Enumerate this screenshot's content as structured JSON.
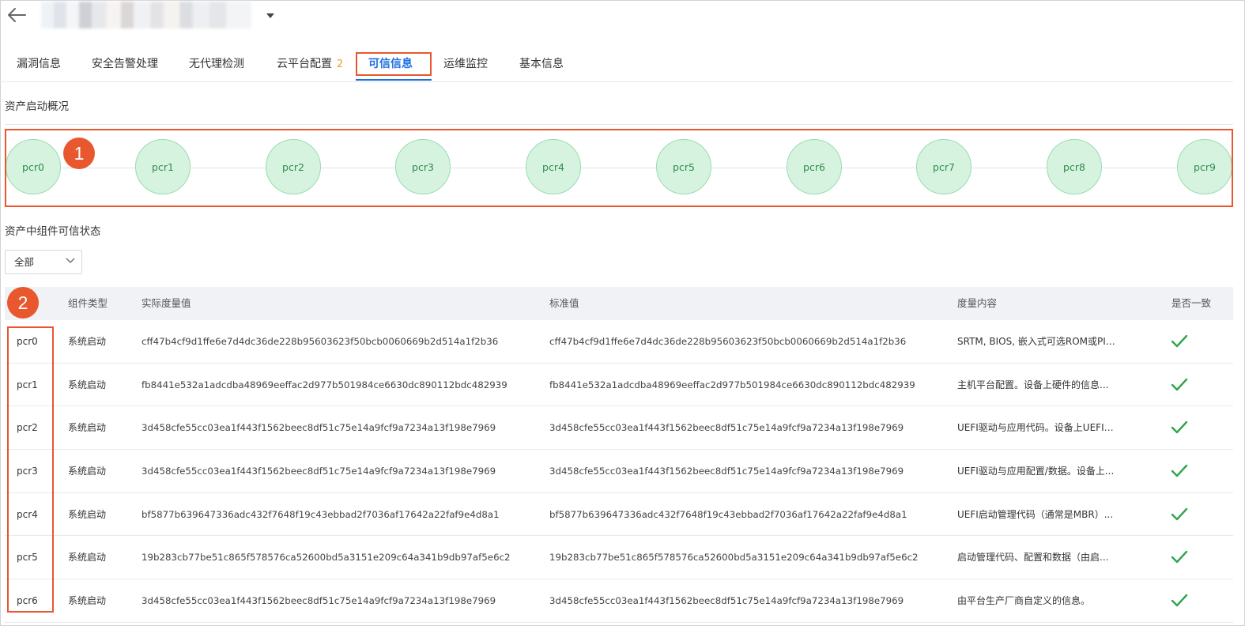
{
  "header": {
    "back_label": "back-arrow-icon",
    "asset_name": ""
  },
  "tabs": [
    {
      "label": "漏洞信息",
      "badge": ""
    },
    {
      "label": "安全告警处理",
      "badge": ""
    },
    {
      "label": "无代理检测",
      "badge": ""
    },
    {
      "label": "云平台配置",
      "badge": "2"
    },
    {
      "label": "可信信息",
      "badge": ""
    },
    {
      "label": "运维监控",
      "badge": ""
    },
    {
      "label": "基本信息",
      "badge": ""
    }
  ],
  "active_tab": "可信信息",
  "boot_overview": {
    "title": "资产启动概况",
    "nodes": [
      "pcr0",
      "pcr1",
      "pcr2",
      "pcr3",
      "pcr4",
      "pcr5",
      "pcr6",
      "pcr7",
      "pcr8",
      "pcr9"
    ]
  },
  "markers": {
    "one": "1",
    "two": "2"
  },
  "components": {
    "title": "资产中组件可信状态",
    "filter_value": "全部",
    "columns": [
      "",
      "组件类型",
      "实际度量值",
      "标准值",
      "度量内容",
      "是否一致"
    ],
    "rows": [
      {
        "pcr": "pcr0",
        "type": "系统启动",
        "actual": "cff47b4cf9d1ffe6e7d4dc36de228b95603623f50bcb0060669b2d514a1f2b36",
        "standard": "cff47b4cf9d1ffe6e7d4dc36de228b95603623f50bcb0060669b2d514a1f2b36",
        "content": "SRTM, BIOS, 嵌入式可选ROM或PI驱...",
        "consistent": true
      },
      {
        "pcr": "pcr1",
        "type": "系统启动",
        "actual": "fb8441e532a1adcdba48969eeffac2d977b501984ce6630dc890112bdc482939",
        "standard": "fb8441e532a1adcdba48969eeffac2d977b501984ce6630dc890112bdc482939",
        "content": "主机平台配置。设备上硬件的信息...",
        "consistent": true
      },
      {
        "pcr": "pcr2",
        "type": "系统启动",
        "actual": "3d458cfe55cc03ea1f443f1562beec8df51c75e14a9fcf9a7234a13f198e7969",
        "standard": "3d458cfe55cc03ea1f443f1562beec8df51c75e14a9fcf9a7234a13f198e7969",
        "content": "UEFI驱动与应用代码。设备上UEFI固...",
        "consistent": true
      },
      {
        "pcr": "pcr3",
        "type": "系统启动",
        "actual": "3d458cfe55cc03ea1f443f1562beec8df51c75e14a9fcf9a7234a13f198e7969",
        "standard": "3d458cfe55cc03ea1f443f1562beec8df51c75e14a9fcf9a7234a13f198e7969",
        "content": "UEFI驱动与应用配置/数据。设备上...",
        "consistent": true
      },
      {
        "pcr": "pcr4",
        "type": "系统启动",
        "actual": "bf5877b639647336adc432f7648f19c43ebbad2f7036af17642a22faf9e4d8a1",
        "standard": "bf5877b639647336adc432f7648f19c43ebbad2f7036af17642a22faf9e4d8a1",
        "content": "UEFI启动管理代码（通常是MBR）...",
        "consistent": true
      },
      {
        "pcr": "pcr5",
        "type": "系统启动",
        "actual": "19b283cb77be51c865f578576ca52600bd5a3151e209c64a341b9db97af5e6c2",
        "standard": "19b283cb77be51c865f578576ca52600bd5a3151e209c64a341b9db97af5e6c2",
        "content": "启动管理代码、配置和数据（由启...",
        "consistent": true
      },
      {
        "pcr": "pcr6",
        "type": "系统启动",
        "actual": "3d458cfe55cc03ea1f443f1562beec8df51c75e14a9fcf9a7234a13f198e7969",
        "standard": "3d458cfe55cc03ea1f443f1562beec8df51c75e14a9fcf9a7234a13f198e7969",
        "content": "由平台生产厂商自定义的信息。",
        "consistent": true
      }
    ]
  },
  "colors": {
    "accent": "#1f6fe0",
    "highlight": "#e8572e",
    "badge": "#f0a020",
    "node_fill": "#d6f3e0",
    "node_text": "#2e8c4d",
    "check": "#2ea44f"
  }
}
